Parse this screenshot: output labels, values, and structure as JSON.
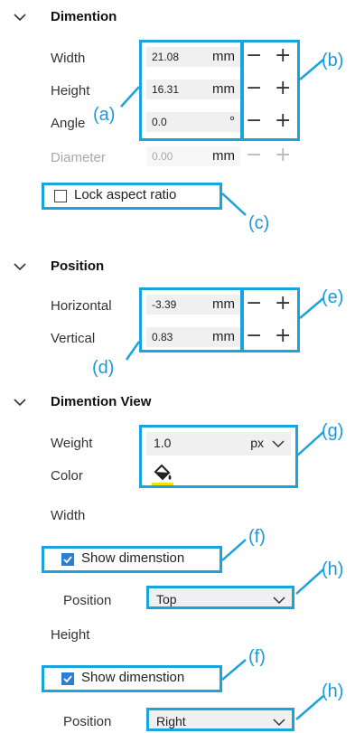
{
  "dimension": {
    "title": "Dimention",
    "width": {
      "label": "Width",
      "value": "21.08",
      "unit": "mm"
    },
    "height": {
      "label": "Height",
      "value": "16.31",
      "unit": "mm"
    },
    "angle": {
      "label": "Angle",
      "value": "0.0",
      "unit": "°"
    },
    "diameter": {
      "label": "Diameter",
      "value": "0.00",
      "unit": "mm"
    },
    "lock_label": "Lock aspect ratio"
  },
  "position": {
    "title": "Position",
    "horizontal": {
      "label": "Horizontal",
      "value": "-3.39",
      "unit": "mm"
    },
    "vertical": {
      "label": "Vertical",
      "value": "0.83",
      "unit": "mm"
    }
  },
  "dimension_view": {
    "title": "Dimention View",
    "weight": {
      "label": "Weight",
      "value": "1.0",
      "unit": "px"
    },
    "color": {
      "label": "Color",
      "swatch": "#f5e400"
    },
    "width_section": {
      "title": "Width",
      "show_label": "Show dimenstion",
      "checked": true,
      "position_label": "Position",
      "position_value": "Top"
    },
    "height_section": {
      "title": "Height",
      "show_label": "Show dimenstion",
      "checked": true,
      "position_label": "Position",
      "position_value": "Right"
    }
  },
  "symbols": {
    "minus": "−",
    "plus": "+"
  },
  "callouts": {
    "a": "(a)",
    "b": "(b)",
    "c": "(c)",
    "d": "(d)",
    "e": "(e)",
    "f1": "(f)",
    "g": "(g)",
    "h1": "(h)",
    "f2": "(f)",
    "h2": "(h)"
  },
  "colors": {
    "accent": "#1aa3dd",
    "checkbox": "#2a7fd4"
  }
}
